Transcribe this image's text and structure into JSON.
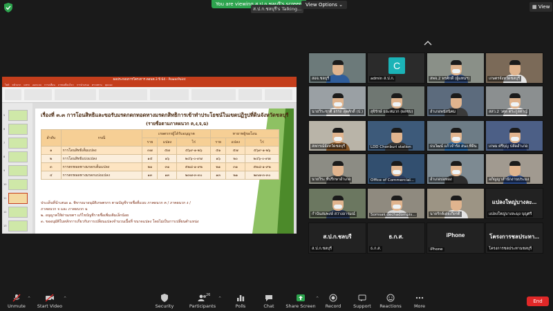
{
  "top": {
    "viewing": "You are viewing ส.ป.ก.ชลบุรี's screen",
    "speaker": "ส.ป.ก.ชลบุรี's Talking...",
    "view_options": "View Options",
    "view": "View"
  },
  "slide": {
    "window_title": "ผลประกอบการโครงการ ดอนท.3 ปี 64 - PowerPoint",
    "ribbon_tabs": [
      "ไฟล์",
      "หน้าแรก",
      "แทรก",
      "ออกแบบ",
      "การเปลี่ยน",
      "ภาพเคลื่อนไหว",
      "การนำเสนอ",
      "ตรวจทาน",
      "มุมมอง"
    ],
    "title": "เรื่องที่ ๓.๓ การโอนสิทธิและขอรับมรดกตกทอดทางมรดกสิทธิการเข้าทำประโยชน์ในเขตปฏิรูปที่ดินจังหวัดชลบุรี",
    "subtitle": "(รายชื่อตามภาคผนวก ค,ง,จ,ฉ)",
    "headers": {
      "no": "ลำดับ",
      "case": "กรณี",
      "group1": "เกษตรกรผู้ได้รับอนุญาต",
      "group2": "ทายาทผู้ขอโอน",
      "sub": [
        "ราย",
        "แปลง",
        "ไร่",
        "ราย",
        "แปลง",
        "ไร่"
      ]
    },
    "rows": [
      {
        "no": "๑",
        "case": "การโอนสิทธิเต็มแปลง",
        "v": [
          "๓๗",
          "๕๗",
          "๕๖๙-๑-๒๖",
          "๕๑",
          "๕๗",
          "๕๖๙-๑-๒๖"
        ]
      },
      {
        "no": "๒",
        "case": "การโอนสิทธิแบ่งแปลง",
        "v": [
          "๑๕",
          "๑๖",
          "๒๔๖-๐-๙๗",
          "๑๖",
          "๒๐",
          "๒๔๖-๐-๙๗"
        ]
      },
      {
        "no": "๓",
        "case": "การตกทอดทางมรดกเต็มแปลง",
        "v": [
          "๒๑",
          "๓๑",
          "๕๒๘-๑-๙๒",
          "๒๑",
          "๓๑",
          "๕๒๘-๑-๙๒"
        ]
      },
      {
        "no": "๔",
        "case": "การตกทอดทางมรดกแบ่งแปลง",
        "v": [
          "๑๓",
          "๑๓",
          "๒๓๗-๓-๓๐",
          "๑๓",
          "๒๑",
          "๒๓๗-๓-๓๐"
        ]
      }
    ],
    "notes": [
      "ประเด็นที่นำเสนอ   ๑. พิจารณาอนุมัติเกษตรกร ตามบัญชีรายชื่อที่แนบ ภาคผนวก ค / ภาคผนวก ง /",
      "ภาคผนวก จ และ ภาคผนวก ฉ",
      "   ๒. อนุญาตให้ผ่านเขตฯ แก้ไขบัญชีรายชื่อเพิ่มเติมเล็กน้อย",
      "   ๓. ขออนุมัติในหลักการเกี่ยวกับการเปลี่ยนแปลงจำนวนเนื้อที่ ขนาดแปลง โดยไม่เป็นการเปลี่ยนตำแหน่ง"
    ]
  },
  "participants": [
    {
      "name": "สอจ.ชลบุรี"
    },
    {
      "name": "admin ส.ป.ก.",
      "initial": "C"
    },
    {
      "name": "สพจ.2 พรศักดิ์ (ผู้แทนฯ)"
    },
    {
      "name": "เกษตรจังหวัดชลบุรี"
    },
    {
      "name": "นายวีระชาติ อรรถ สุดศักดิ์ (ป.)"
    },
    {
      "name": "สุจิรักษ์ ธอะหมวก (ผลชบ)"
    },
    {
      "name": "อำเภอพนัสนิคม"
    },
    {
      "name": "สสว.2 วศุต ตระกูลทาญ์"
    },
    {
      "name": "สหกรณ์จังหวัดชลบุรี"
    },
    {
      "name": "LDD Chonburi station"
    },
    {
      "name": "ธนวัฒน์ แก้วจำรัส สนง.ที่ดิน"
    },
    {
      "name": "เกษม ศรีบุญ ปลัดอำเภอ"
    },
    {
      "name": "นายวีระ ที่ปรึกษาอำเภอ"
    },
    {
      "name": "Office of Commercial..."
    },
    {
      "name": "อำเภอบ่อทอง"
    },
    {
      "name": "อภิญญาสำนักงานประมง"
    },
    {
      "name": "กำนันสมพงษ์ สว่างอารมณ์"
    },
    {
      "name": "Somsak dechadompis..."
    },
    {
      "name": "นายรักต์เด่ยเกียรติ"
    },
    {
      "name": "แปลงใหญ่บางละมุง บุญศรี",
      "label": "แปลงใหญ่บางละ..."
    },
    {
      "name": "ส.ป.ก.ชลบุรี",
      "label": "ส.ป.ก.ชลบรี"
    },
    {
      "name": "ธ.ก.ส.",
      "label": "ธ.ก.ส."
    },
    {
      "name": "iPhone",
      "label": "iPhone"
    },
    {
      "name": "โครงการชลประทานชลบุรี",
      "label": "โครงการชลประทา..."
    }
  ],
  "toolbar": {
    "unmute": "Unmute",
    "start_video": "Start Video",
    "security": "Security",
    "participants": "Participants",
    "participants_count": "26",
    "polls": "Polls",
    "chat": "Chat",
    "share_screen": "Share Screen",
    "record": "Record",
    "support": "Support",
    "reactions": "Reactions",
    "more": "More",
    "end": "End"
  },
  "colors": {
    "share_green": "#2da44e",
    "end_red": "#e02828",
    "ppt_brand": "#c43e1c"
  }
}
